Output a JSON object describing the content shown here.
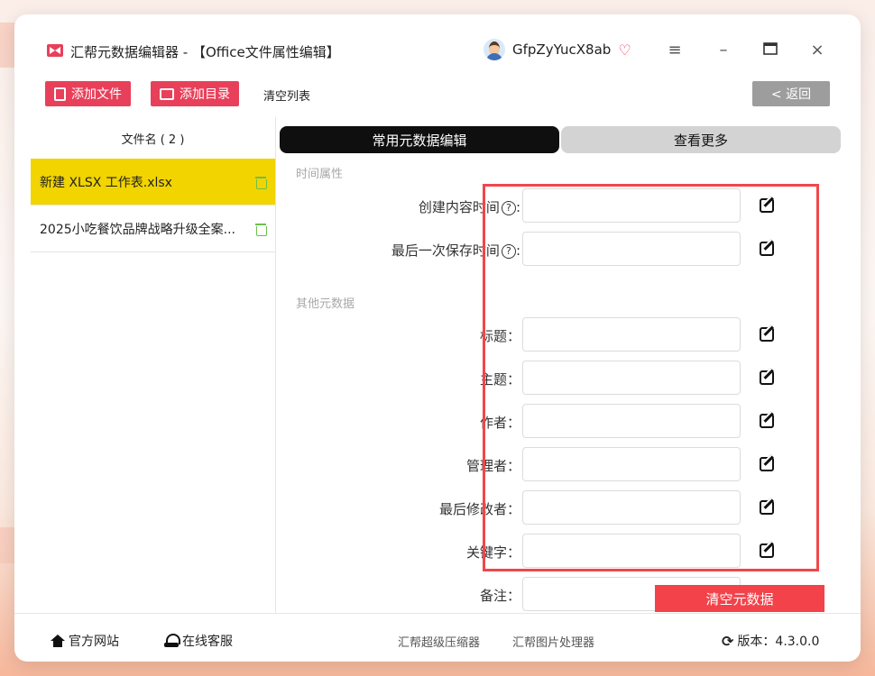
{
  "app": {
    "title": "汇帮元数据编辑器 - 【Office文件属性编辑】",
    "username": "GfpZyYucX8ab"
  },
  "toolbar": {
    "add_file": "添加文件",
    "add_dir": "添加目录",
    "clear_list": "清空列表",
    "back": "< 返回"
  },
  "sidebar": {
    "header": "文件名 ( 2 )",
    "files": [
      {
        "name": "新建 XLSX 工作表.xlsx"
      },
      {
        "name": "2025小吃餐饮品牌战略升级全案..."
      }
    ]
  },
  "tabs": {
    "common": "常用元数据编辑",
    "more": "查看更多"
  },
  "sections": {
    "time": "时间属性",
    "other": "其他元数据"
  },
  "fields": {
    "created": {
      "label": "创建内容时间",
      "value": ""
    },
    "saved": {
      "label": "最后一次保存时间",
      "value": ""
    },
    "title": {
      "label": "标题：",
      "value": ""
    },
    "subject": {
      "label": "主题：",
      "value": ""
    },
    "author": {
      "label": "作者：",
      "value": ""
    },
    "manager": {
      "label": "管理者：",
      "value": ""
    },
    "last_modified_by": {
      "label": "最后修改者：",
      "value": ""
    },
    "keywords": {
      "label": "关键字：",
      "value": ""
    },
    "notes": {
      "label": "备注：",
      "value": ""
    }
  },
  "actions": {
    "clear_meta": "清空元数据"
  },
  "footer": {
    "website": "官方网站",
    "support": "在线客服",
    "compressor": "汇帮超级压缩器",
    "image_tool": "汇帮图片处理器",
    "version": "版本：4.3.0.0"
  },
  "colors": {
    "accent": "#e8405a",
    "selected_row": "#f1d400",
    "highlight": "#f0474b"
  }
}
